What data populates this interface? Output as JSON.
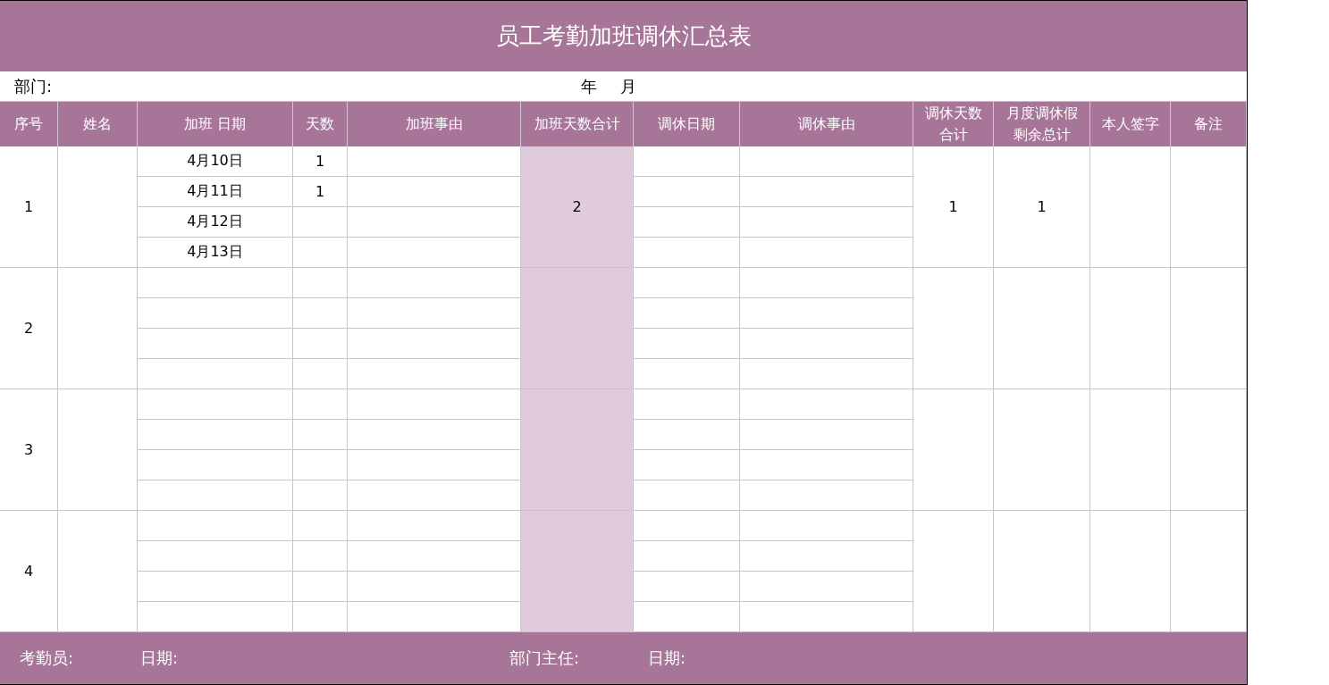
{
  "title": "员工考勤加班调休汇总表",
  "info_bar": {
    "department_label": "部门:",
    "year_label": "年",
    "month_label": "月"
  },
  "columns": [
    {
      "lines": [
        "序号"
      ]
    },
    {
      "lines": [
        "姓名"
      ]
    },
    {
      "lines": [
        "加班 日期"
      ]
    },
    {
      "lines": [
        "天数"
      ]
    },
    {
      "lines": [
        "加班事由"
      ]
    },
    {
      "lines": [
        "加班天数合计"
      ]
    },
    {
      "lines": [
        "调休日期"
      ]
    },
    {
      "lines": [
        "调休事由"
      ]
    },
    {
      "lines": [
        "调休天数",
        "合计"
      ]
    },
    {
      "lines": [
        "月度调休假",
        "剩余总计"
      ]
    },
    {
      "lines": [
        "本人签字"
      ]
    },
    {
      "lines": [
        "备注"
      ]
    }
  ],
  "groups": [
    {
      "seq": "1",
      "overtime_total": "2",
      "leave_total": "1",
      "remaining_total": "1",
      "entries": [
        {
          "date": "4月10日",
          "days": "1"
        },
        {
          "date": "4月11日",
          "days": "1"
        },
        {
          "date": "4月12日"
        },
        {
          "date": "4月13日"
        }
      ]
    },
    {
      "seq": "2"
    },
    {
      "seq": "3"
    },
    {
      "seq": "4"
    }
  ],
  "footer": [
    "考勤员:",
    "日期:",
    "部门主任:",
    "日期:"
  ]
}
